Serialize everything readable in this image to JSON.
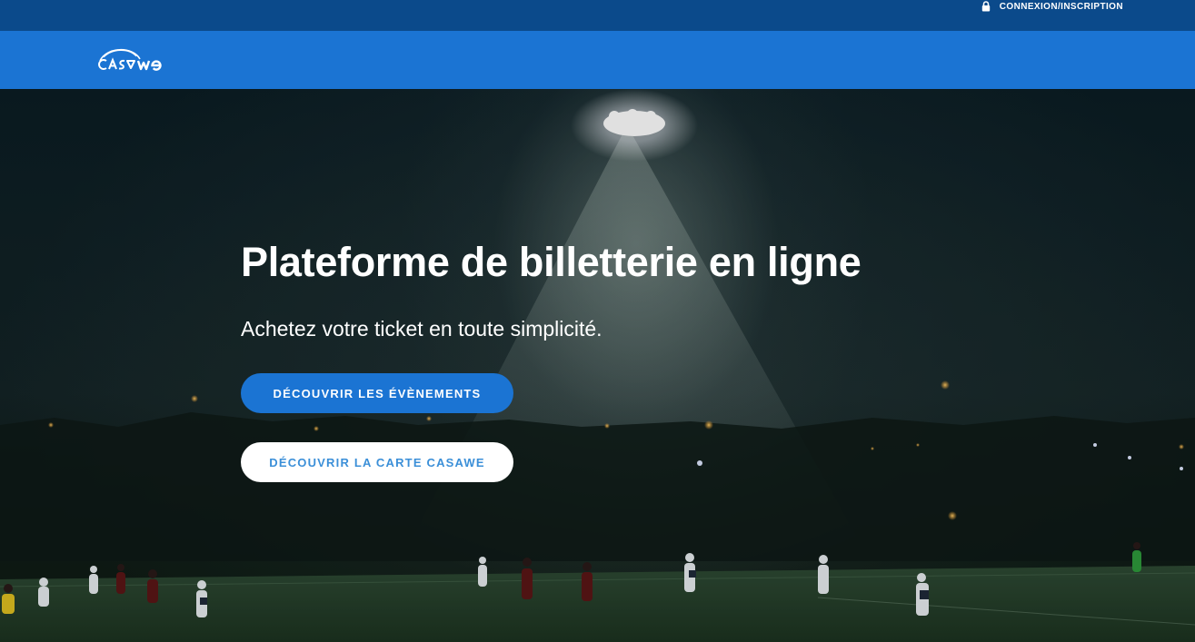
{
  "topbar": {
    "login_label": "CONNEXION/INSCRIPTION",
    "lock_icon": "lock-icon",
    "background": "#0b4a8b"
  },
  "navbar": {
    "logo_text": "CASAWE",
    "background": "#1b74d3"
  },
  "hero": {
    "title": "Plateforme de billetterie en ligne",
    "subtitle": "Achetez votre ticket en toute simplicité.",
    "primary_button": "DÉCOUVRIR LES ÉVÈNEMENTS",
    "secondary_button": "DÉCOUVRIR LA CARTE CASAWE",
    "primary_color": "#1b74d3",
    "secondary_text_color": "#3b8fd8",
    "background_image": "night-football-match-under-floodlight"
  }
}
